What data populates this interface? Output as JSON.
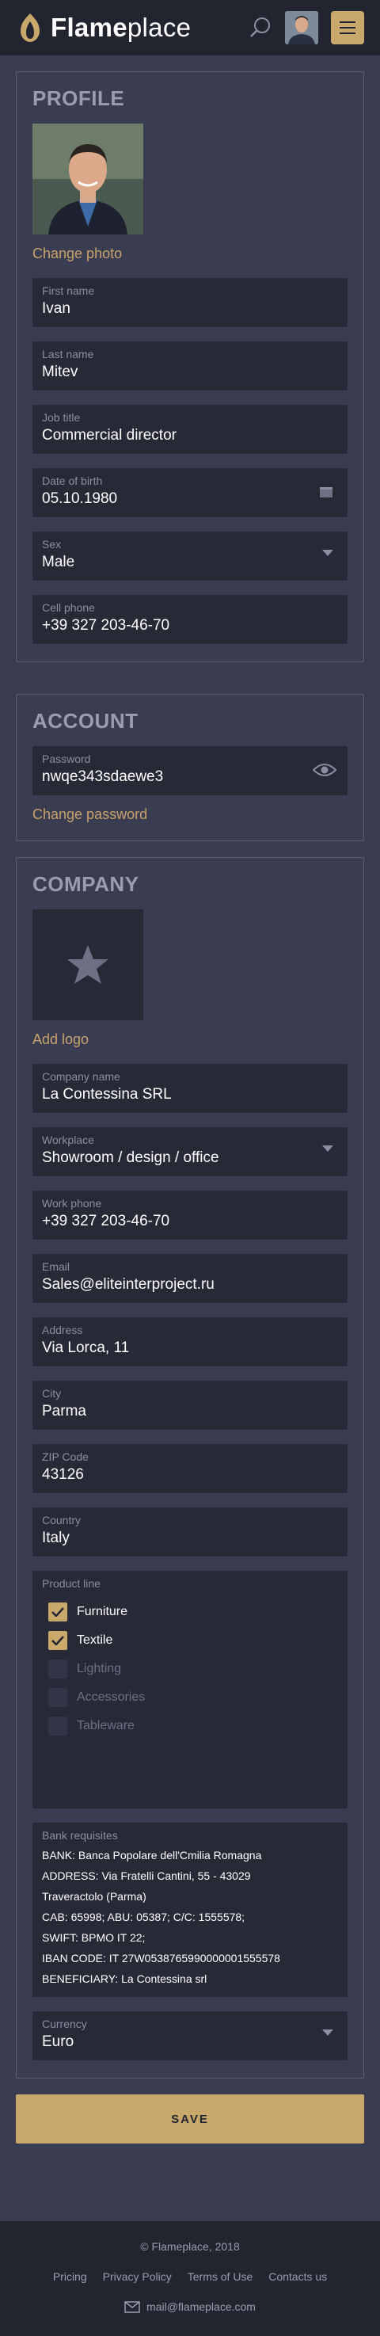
{
  "header": {
    "logo_bold": "Flame",
    "logo_light": "place",
    "colors": {
      "accent": "#c8a86b",
      "header_bg": "#22242f",
      "page_bg": "#3a3d51",
      "field_bg": "#272936"
    }
  },
  "profile": {
    "title": "PROFILE",
    "change_photo": "Change photo",
    "fields": [
      {
        "label": "First name",
        "value": "Ivan"
      },
      {
        "label": "Last name",
        "value": "Mitev"
      },
      {
        "label": "Job title",
        "value": "Commercial director"
      },
      {
        "label": "Date of birth",
        "value": "05.10.1980",
        "icon": "calendar-icon"
      },
      {
        "label": "Sex",
        "value": "Male",
        "icon": "dropdown-arrow-icon"
      },
      {
        "label": "Cell phone",
        "value": "+39 327 203-46-70"
      }
    ]
  },
  "account": {
    "title": "ACCOUNT",
    "password_label": "Password",
    "password_value": "nwqe343sdaewe3",
    "password_icon": "eye-icon",
    "change_password": "Change password"
  },
  "company": {
    "title": "COMPANY",
    "add_logo": "Add logo",
    "logo_icon": "star-icon",
    "fields": [
      {
        "label": "Company name",
        "value": "La Contessina SRL"
      },
      {
        "label": "Workplace",
        "value": "Showroom / design / office",
        "icon": "dropdown-arrow-icon"
      },
      {
        "label": "Work phone",
        "value": "+39 327 203-46-70"
      },
      {
        "label": "Email",
        "value": "Sales@eliteinterproject.ru"
      },
      {
        "label": "Address",
        "value": "Via Lorca, 11"
      },
      {
        "label": "City",
        "value": "Parma"
      },
      {
        "label": "ZIP Code",
        "value": "43126"
      },
      {
        "label": "Country",
        "value": "Italy"
      }
    ],
    "product_line": {
      "label": "Product line",
      "items": [
        {
          "label": "Furniture",
          "checked": true
        },
        {
          "label": "Textile",
          "checked": true
        },
        {
          "label": "Lighting",
          "checked": false
        },
        {
          "label": "Accessories",
          "checked": false
        },
        {
          "label": "Tableware",
          "checked": false
        }
      ]
    },
    "bank": {
      "label": "Bank requisites",
      "lines": [
        "BANK: Banca Popolare dell'Cmilia Romagna",
        "ADDRESS: Via Fratelli Cantini, 55 - 43029",
        "Traveractolo (Parma)",
        "CAB: 65998; ABU: 05387; C/C: 1555578;",
        "SWIFT: BPMO IT 22;",
        "IBAN CODE: IT 27W0538765990000001555578",
        "BENEFICIARY: La Contessina srl"
      ]
    },
    "currency": {
      "label": "Currency",
      "value": "Euro",
      "icon": "dropdown-arrow-icon"
    }
  },
  "save_label": "SAVE",
  "footer": {
    "copyright": "© Flameplace, 2018",
    "links": [
      "Pricing",
      "Privacy Policy",
      "Terms of Use",
      "Contacts us"
    ],
    "email": "mail@flameplace.com",
    "email_icon": "mail-icon"
  }
}
